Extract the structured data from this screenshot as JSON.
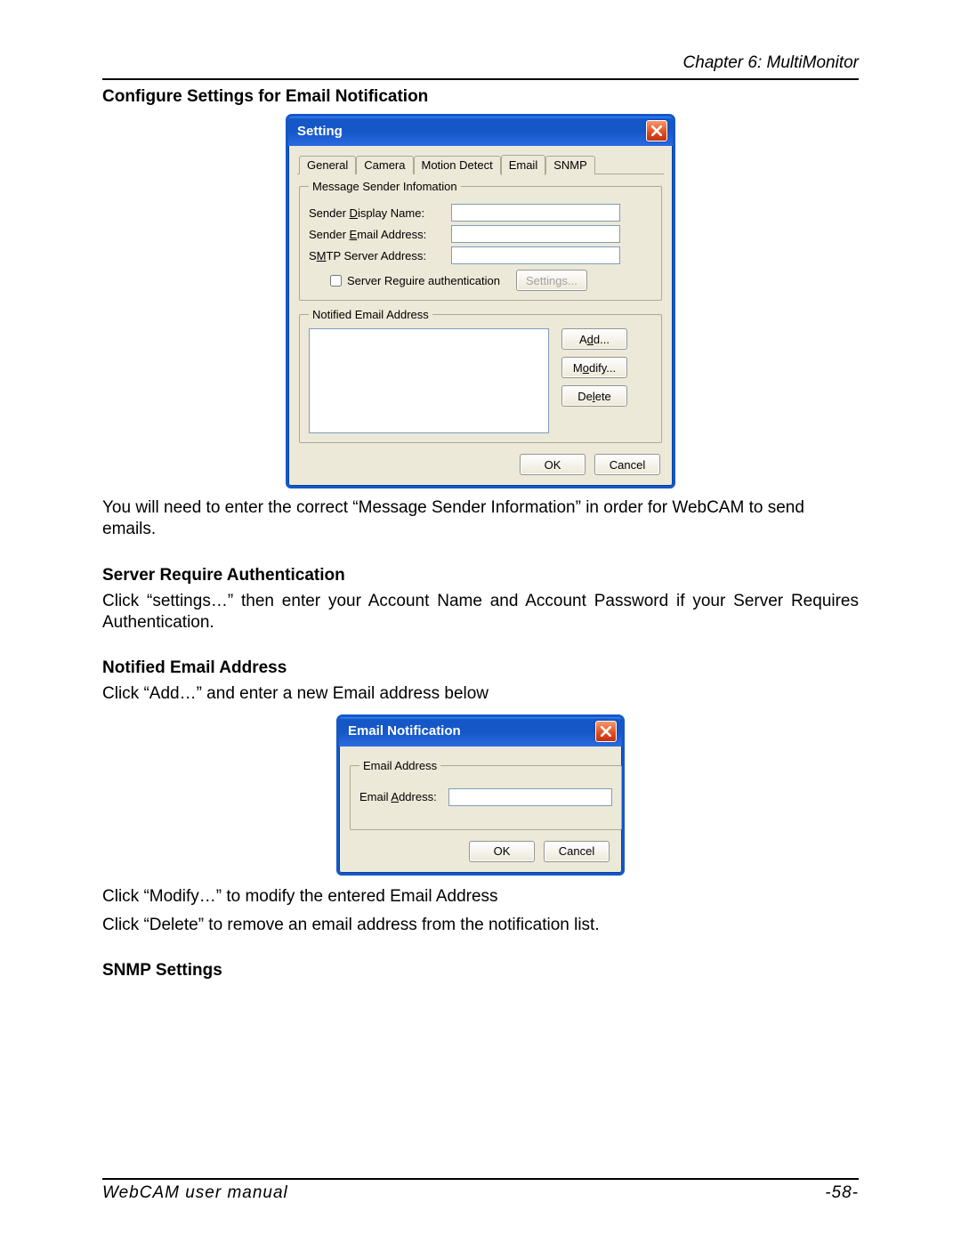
{
  "header": {
    "chapter": "Chapter 6: MultiMonitor"
  },
  "sections": {
    "h1": "Configure Settings for Email Notification",
    "p1": "You will need to enter the correct “Message Sender Information” in order for WebCAM to send emails.",
    "h2": "Server Require Authentication",
    "p2": "Click “settings…” then enter your Account Name and Account Password if your Server Requires Authentication.",
    "h3": "Notified Email Address",
    "p3": "Click “Add…” and enter a new Email address below",
    "p4": "Click “Modify…” to modify the entered Email Address",
    "p5": "Click “Delete” to remove an email address from the notification list.",
    "h4": "SNMP Settings"
  },
  "dialog1": {
    "title": "Setting",
    "tabs": [
      "General",
      "Camera",
      "Motion Detect",
      "Email",
      "SNMP"
    ],
    "active_tab": "Email",
    "group1_legend": "Message Sender Infomation",
    "sender_display_label": "Sender Display Name:",
    "sender_display_u": "D",
    "sender_email_label": "Sender Email Address:",
    "sender_email_u": "E",
    "smtp_label": "SMTP Server Address:",
    "smtp_u": "M",
    "auth_label": "Server Reguire authentication",
    "settings_btn": "Settings...",
    "group2_legend": "Notified Email Address",
    "add_btn": "Add...",
    "add_u": "d",
    "modify_btn": "Modify...",
    "modify_u": "o",
    "delete_btn": "Delete",
    "delete_u": "l",
    "ok": "OK",
    "cancel": "Cancel"
  },
  "dialog2": {
    "title": "Email Notification",
    "group_legend": "Email Address",
    "field_label": "Email Address:",
    "field_u": "A",
    "ok": "OK",
    "cancel": "Cancel"
  },
  "footer": {
    "manual": "WebCAM  user  manual",
    "page": "-58-"
  }
}
